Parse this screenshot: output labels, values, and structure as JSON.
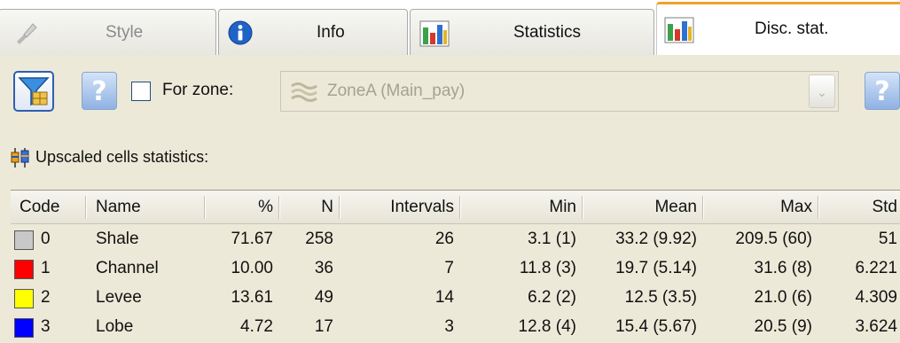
{
  "tabs": [
    {
      "label": "Style",
      "icon": "brush-icon",
      "state": "disabled"
    },
    {
      "label": "Info",
      "icon": "info-icon",
      "state": "normal"
    },
    {
      "label": "Statistics",
      "icon": "bar-chart-icon",
      "state": "normal"
    },
    {
      "label": "Disc. stat.",
      "icon": "bar-chart-icon",
      "state": "active"
    }
  ],
  "toolbar": {
    "filter_icon": "filter-icon",
    "help_icon": "question-icon",
    "help_glyph": "?",
    "zone_checkbox_checked": false,
    "zone_label": "For zone:",
    "zone_value": "ZoneA (Main_pay)",
    "zone_icon": "zone-layers-icon",
    "dropdown_icon": "chevron-down-icon"
  },
  "section": {
    "title": "Upscaled cells statistics:",
    "icon": "boxplot-icon"
  },
  "table": {
    "columns": [
      "Code",
      "Name",
      "%",
      "N",
      "Intervals",
      "Min",
      "Mean",
      "Max",
      "Std"
    ],
    "rows": [
      {
        "code": "0",
        "color": "#c8c8c8",
        "name": "Shale",
        "pct": "71.67",
        "n": "258",
        "intervals": "26",
        "min": "3.1 (1)",
        "mean": "33.2 (9.92)",
        "max": "209.5 (60)",
        "std": "51"
      },
      {
        "code": "1",
        "color": "#ff0000",
        "name": "Channel",
        "pct": "10.00",
        "n": "36",
        "intervals": "7",
        "min": "11.8 (3)",
        "mean": "19.7 (5.14)",
        "max": "31.6 (8)",
        "std": "6.221"
      },
      {
        "code": "2",
        "color": "#ffff00",
        "name": "Levee",
        "pct": "13.61",
        "n": "49",
        "intervals": "14",
        "min": "6.2 (2)",
        "mean": "12.5 (3.5)",
        "max": "21.0 (6)",
        "std": "4.309"
      },
      {
        "code": "3",
        "color": "#0000ff",
        "name": "Lobe",
        "pct": "4.72",
        "n": "17",
        "intervals": "3",
        "min": "12.8 (4)",
        "mean": "15.4 (5.67)",
        "max": "20.5 (9)",
        "std": "3.624"
      }
    ]
  }
}
